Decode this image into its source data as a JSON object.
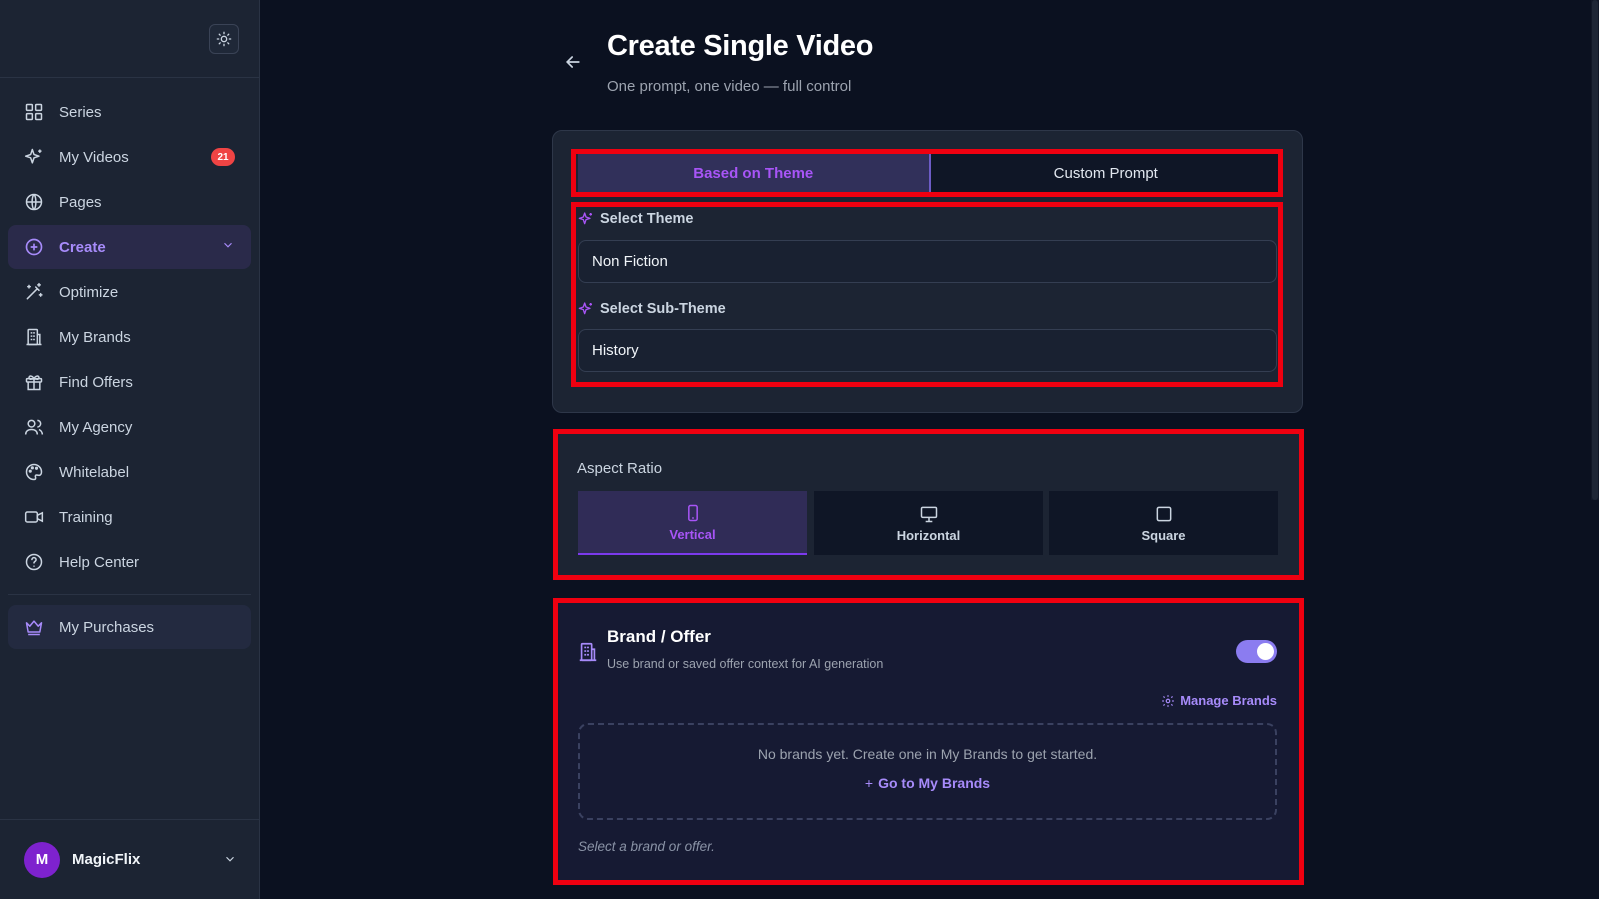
{
  "sidebar": {
    "items": [
      {
        "label": "Series",
        "icon": "grid-icon"
      },
      {
        "label": "My Videos",
        "icon": "sparkles-icon",
        "badge": "21"
      },
      {
        "label": "Pages",
        "icon": "globe-icon"
      },
      {
        "label": "Create",
        "icon": "plus-circle-icon",
        "active": true
      },
      {
        "label": "Optimize",
        "icon": "wand-icon"
      },
      {
        "label": "My Brands",
        "icon": "building-icon"
      },
      {
        "label": "Find Offers",
        "icon": "gift-icon"
      },
      {
        "label": "My Agency",
        "icon": "users-icon"
      },
      {
        "label": "Whitelabel",
        "icon": "palette-icon"
      },
      {
        "label": "Training",
        "icon": "video-icon"
      },
      {
        "label": "Help Center",
        "icon": "help-icon"
      }
    ],
    "purchases": {
      "label": "My Purchases",
      "icon": "crown-icon"
    },
    "user": {
      "initial": "M",
      "name": "MagicFlix"
    }
  },
  "header": {
    "title": "Create Single Video",
    "subtitle": "One prompt, one video — full control"
  },
  "mode_tabs": [
    {
      "label": "Based on Theme",
      "selected": true
    },
    {
      "label": "Custom Prompt",
      "selected": false
    }
  ],
  "theme": {
    "label": "Select Theme",
    "value": "Non Fiction"
  },
  "sub_theme": {
    "label": "Select Sub-Theme",
    "value": "History"
  },
  "aspect_ratio": {
    "label": "Aspect Ratio",
    "options": [
      {
        "label": "Vertical",
        "selected": true
      },
      {
        "label": "Horizontal",
        "selected": false
      },
      {
        "label": "Square",
        "selected": false
      }
    ]
  },
  "brand_offer": {
    "title": "Brand / Offer",
    "description": "Use brand or saved offer context for AI generation",
    "enabled": true,
    "manage_label": "Manage Brands",
    "empty_text": "No brands yet. Create one in My Brands to get started.",
    "goto_label": "Go to My Brands",
    "hint": "Select a brand or offer."
  },
  "colors": {
    "accent": "#a855f7",
    "highlight": "#ef0010",
    "badge": "#ef4444"
  }
}
